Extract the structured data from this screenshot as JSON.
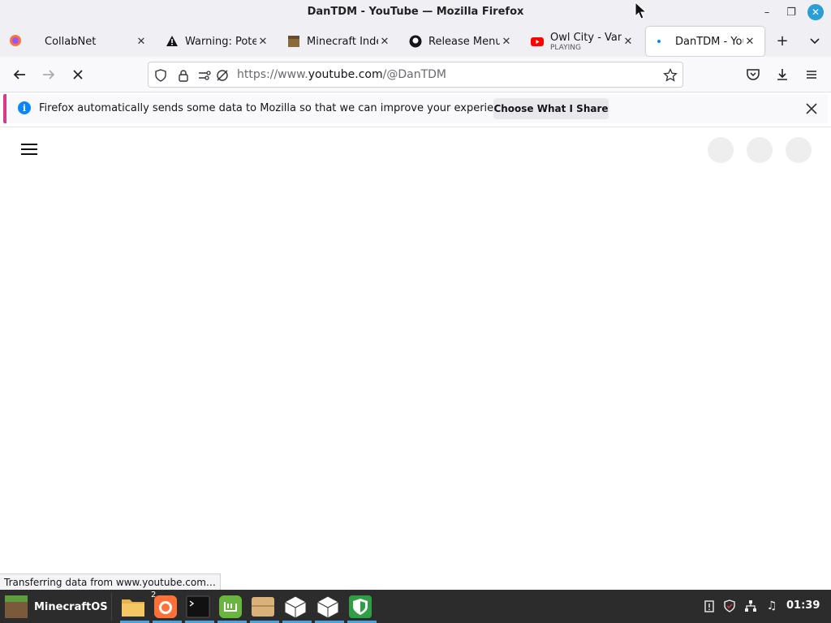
{
  "window": {
    "title": "DanTDM - YouTube — Mozilla Firefox"
  },
  "tabs": [
    {
      "label": "CollabNet",
      "icon": "collabnet-favicon"
    },
    {
      "label": "Warning: Poten",
      "icon": "warning-icon"
    },
    {
      "label": "Minecraft Index",
      "icon": "minecraft-icon"
    },
    {
      "label": "Release MenuL",
      "icon": "github-icon"
    },
    {
      "label": "Owl City - Vanil",
      "sub": "PLAYING",
      "icon": "youtube-icon"
    },
    {
      "label": "DanTDM - YouT",
      "icon": "loading-dot-icon",
      "active": true
    }
  ],
  "navbar": {
    "url_prefix": "https://www.",
    "url_domain": "youtube.com",
    "url_path": "/@DanTDM"
  },
  "notification": {
    "message": "Firefox automatically sends some data to Mozilla so that we can improve your experience.",
    "button": "Choose What I Share"
  },
  "status": {
    "text": "Transferring data from www.youtube.com…"
  },
  "taskbar": {
    "start_label": "MinecraftOS",
    "badge": "2",
    "clock": "01:39"
  },
  "colors": {
    "accent": "#2a9fd6",
    "notif_stripe": "#d63a8c",
    "info_blue": "#0a84ff",
    "taskbar": "#2c2c2c"
  }
}
